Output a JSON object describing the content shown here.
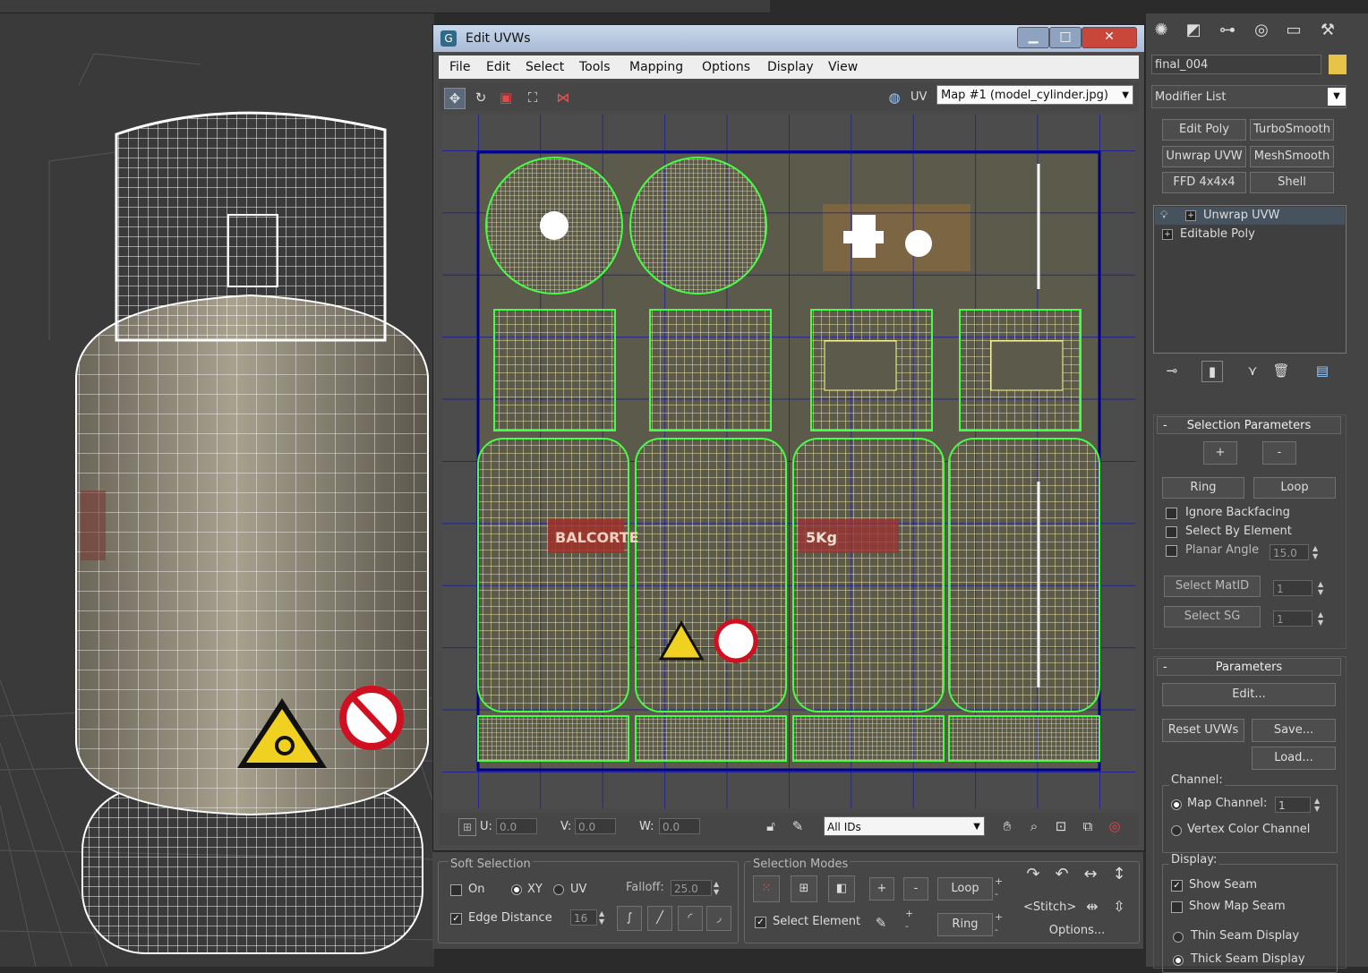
{
  "dialog": {
    "title": "Edit UVWs",
    "menu": [
      "File",
      "Edit",
      "Select",
      "Tools",
      "Mapping",
      "Options",
      "Display",
      "View"
    ],
    "uv_label": "UV",
    "map_selector": "Map #1 (model_cylinder.jpg)",
    "coords": {
      "u_label": "U:",
      "u_value": "0.0",
      "v_label": "V:",
      "v_value": "0.0",
      "w_label": "W:",
      "w_value": "0.0"
    },
    "ids_dropdown": "All IDs",
    "texture_labels": [
      "BALCORTE",
      "5Kg"
    ]
  },
  "soft_selection": {
    "title": "Soft Selection",
    "on_label": "On",
    "xy_label": "XY",
    "uv_label": "UV",
    "falloff_label": "Falloff:",
    "falloff_value": "25.0",
    "edge_distance_label": "Edge Distance",
    "edge_distance_value": "16"
  },
  "selection_modes": {
    "title": "Selection Modes",
    "plus": "+",
    "minus": "-",
    "loop_label": "Loop",
    "ring_label": "Ring",
    "select_element_label": "Select Element",
    "stitch_label": "Stitch",
    "stitch_left": "<",
    "stitch_right": ">",
    "options_label": "Options..."
  },
  "command_panel": {
    "object_name": "final_004",
    "object_color": "#e8c34a",
    "modifier_list_label": "Modifier List",
    "modifier_buttons": [
      "Edit Poly",
      "TurboSmooth",
      "Unwrap UVW",
      "MeshSmooth",
      "FFD 4x4x4",
      "Shell"
    ],
    "stack": [
      "Unwrap UVW",
      "Editable Poly"
    ],
    "selection_parameters": {
      "header": "Selection Parameters",
      "collapse": "-",
      "plus": "+",
      "minus": "-",
      "ring": "Ring",
      "loop": "Loop",
      "ignore_backfacing": "Ignore Backfacing",
      "select_by_element": "Select By Element",
      "planar_angle": "Planar Angle",
      "planar_angle_value": "15.0",
      "select_matid": "Select MatID",
      "matid_value": "1",
      "select_sg": "Select SG",
      "sg_value": "1"
    },
    "parameters": {
      "header": "Parameters",
      "collapse": "-",
      "edit": "Edit...",
      "reset_uvws": "Reset UVWs",
      "save": "Save...",
      "load": "Load...",
      "channel_label": "Channel:",
      "map_channel": "Map Channel:",
      "map_channel_value": "1",
      "vertex_color_channel": "Vertex Color Channel",
      "display_label": "Display:",
      "show_seam": "Show Seam",
      "show_map_seam": "Show Map Seam",
      "thin_seam_display": "Thin Seam Display",
      "thick_seam_display": "Thick Seam Display"
    }
  }
}
